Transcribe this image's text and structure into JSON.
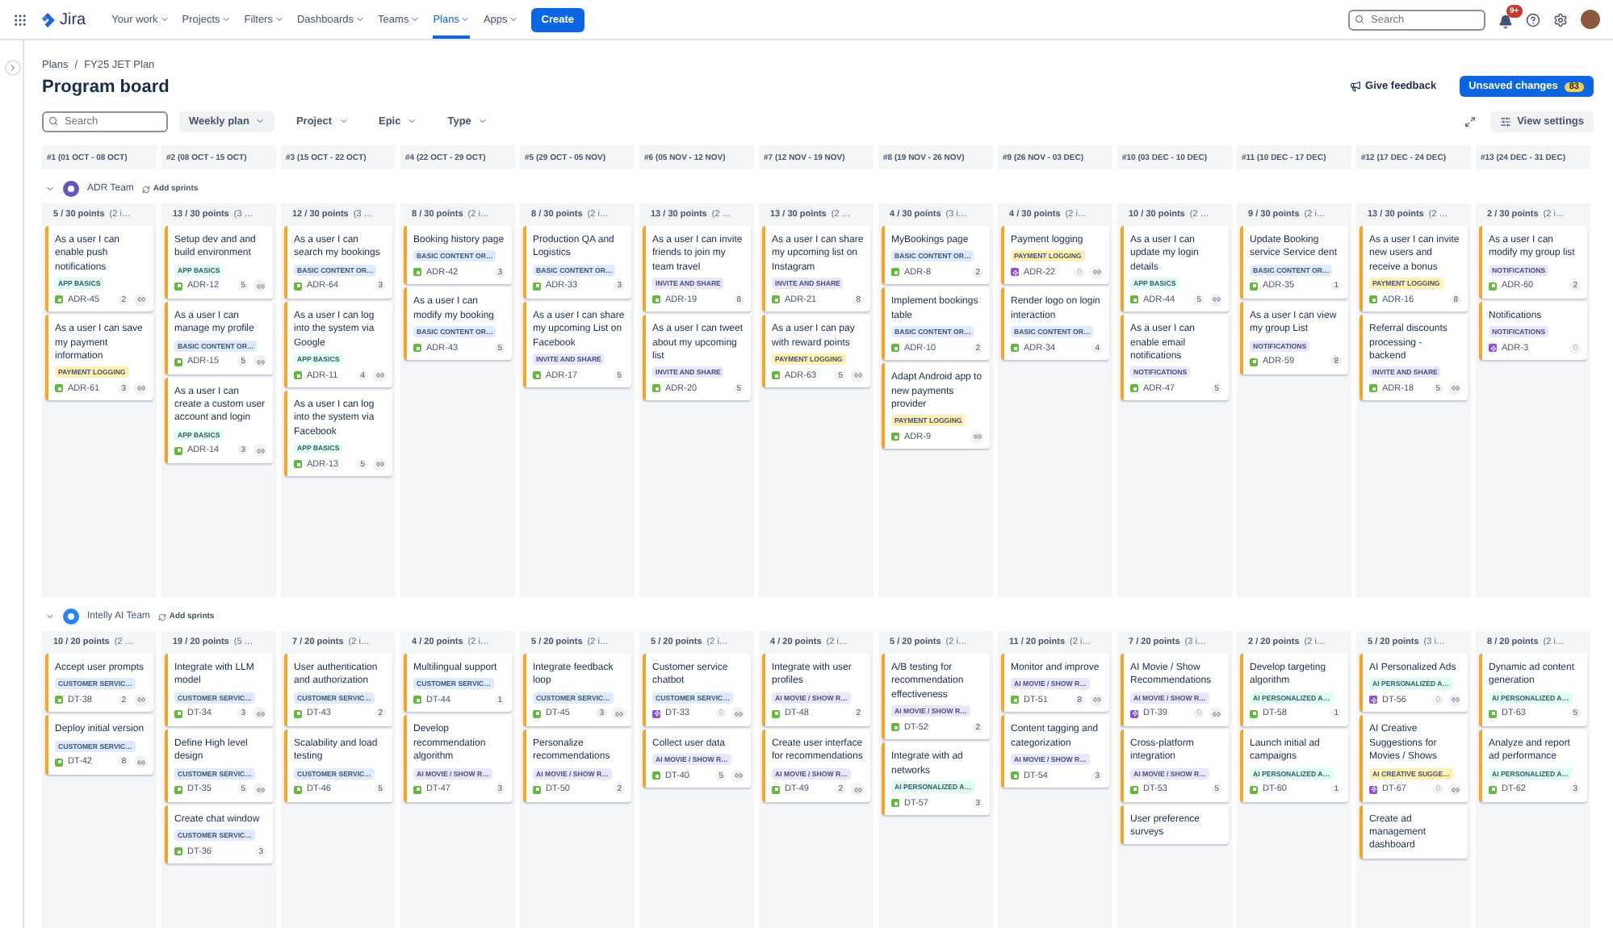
{
  "nav": {
    "product": "Jira",
    "items": [
      {
        "label": "Your work",
        "selected": false
      },
      {
        "label": "Projects",
        "selected": false
      },
      {
        "label": "Filters",
        "selected": false
      },
      {
        "label": "Dashboards",
        "selected": false
      },
      {
        "label": "Teams",
        "selected": false
      },
      {
        "label": "Plans",
        "selected": true
      },
      {
        "label": "Apps",
        "selected": false
      }
    ],
    "create": "Create",
    "search": {
      "placeholder": "Search"
    },
    "notifications": "9+"
  },
  "breadcrumbs": {
    "items": [
      "Plans",
      "FY25 JET Plan"
    ],
    "separator": "/"
  },
  "title": "Program board",
  "feedback": "Give feedback",
  "unsaved": {
    "label": "Unsaved changes",
    "count": "83"
  },
  "filters": {
    "search": {
      "placeholder": "Search"
    },
    "dropdowns": [
      "Weekly plan",
      "Project",
      "Epic",
      "Type"
    ],
    "view_settings": "View settings"
  },
  "sprints": [
    "#1 (01 OCT - 08 OCT)",
    "#2 (08 OCT - 15 OCT)",
    "#3 (15 OCT - 22 OCT)",
    "#4 (22 OCT - 29 OCT)",
    "#5 (29 OCT - 05 NOV)",
    "#6 (05 NOV - 12 NOV)",
    "#7 (12 NOV - 19 NOV)",
    "#8 (19 NOV - 26 NOV)",
    "#9 (26 NOV - 03 DEC)",
    "#10 (03 DEC - 10 DEC)",
    "#11 (10 DEC - 17 DEC)",
    "#12 (17 DEC - 24 DEC)",
    "#13 (24 DEC - 31 DEC)"
  ],
  "teams": [
    {
      "name": "ADR Team",
      "add": "Add sprints",
      "expanded": true,
      "color": "#6554c0",
      "columns": [
        {
          "points": "5 / 30 points",
          "summary": "(2 i…",
          "cards": [
            {
              "title": "As a user I can enable push notifications",
              "tag": {
                "label": "APP BASICS",
                "color": "#dcfff1"
              },
              "key": "ADR-45",
              "kind": "story",
              "points": "2",
              "linked": true
            },
            {
              "title": "As a user I can save my payment information",
              "tag": {
                "label": "PAYMENT LOGGING",
                "color": "#fff0b3"
              },
              "key": "ADR-61",
              "kind": "story",
              "points": "3",
              "linked": true
            }
          ]
        },
        {
          "points": "13 / 30 points",
          "summary": "(3 …",
          "cards": [
            {
              "title": "Setup dev and and build environment",
              "tag": {
                "label": "APP BASICS",
                "color": "#dcfff1"
              },
              "key": "ADR-12",
              "kind": "story",
              "points": "5",
              "linked": true
            },
            {
              "title": "As a user I can manage my profile",
              "tag": {
                "label": "BASIC CONTENT OR…",
                "color": "#deebff"
              },
              "key": "ADR-15",
              "kind": "story",
              "points": "5",
              "linked": true
            },
            {
              "title": "As a user I can create a custom user account and login",
              "tag": {
                "label": "APP BASICS",
                "color": "#dcfff1"
              },
              "key": "ADR-14",
              "kind": "story",
              "points": "3",
              "linked": true
            }
          ]
        },
        {
          "points": "12 / 30 points",
          "summary": "(3 …",
          "cards": [
            {
              "title": "As a user I can search my bookings",
              "tag": {
                "label": "BASIC CONTENT OR…",
                "color": "#deebff"
              },
              "key": "ADR-64",
              "kind": "story",
              "points": "3",
              "linked": false
            },
            {
              "title": "As a user I can log into the system via Google",
              "tag": {
                "label": "APP BASICS",
                "color": "#dcfff1"
              },
              "key": "ADR-11",
              "kind": "story",
              "points": "4",
              "linked": true
            },
            {
              "title": "As a user I can log into the system via Facebook",
              "tag": {
                "label": "APP BASICS",
                "color": "#dcfff1"
              },
              "key": "ADR-13",
              "kind": "story",
              "points": "5",
              "linked": true
            }
          ]
        },
        {
          "points": "8 / 30 points",
          "summary": "(2 i…",
          "cards": [
            {
              "title": "Booking history page",
              "tag": {
                "label": "BASIC CONTENT OR…",
                "color": "#deebff"
              },
              "key": "ADR-42",
              "kind": "story",
              "points": "3",
              "linked": false
            },
            {
              "title": "As a user I can modify my booking",
              "tag": {
                "label": "BASIC CONTENT OR…",
                "color": "#deebff"
              },
              "key": "ADR-43",
              "kind": "story",
              "points": "5",
              "linked": false
            }
          ]
        },
        {
          "points": "8 / 30 points",
          "summary": "(2 i…",
          "cards": [
            {
              "title": "Production QA and Logistics",
              "tag": {
                "label": "BASIC CONTENT OR…",
                "color": "#deebff"
              },
              "key": "ADR-33",
              "kind": "story",
              "points": "3",
              "linked": false
            },
            {
              "title": "As a user I can share my upcoming List on Facebook",
              "tag": {
                "label": "INVITE AND SHARE",
                "color": "#eae6ff"
              },
              "key": "ADR-17",
              "kind": "story",
              "points": "5",
              "linked": false
            }
          ]
        },
        {
          "points": "13 / 30 points",
          "summary": "(2 …",
          "cards": [
            {
              "title": "As a user I can invite friends to join my team travel",
              "tag": {
                "label": "INVITE AND SHARE",
                "color": "#eae6ff"
              },
              "key": "ADR-19",
              "kind": "story",
              "points": "8",
              "linked": false
            },
            {
              "title": "As a user I can tweet about my upcoming list",
              "tag": {
                "label": "INVITE AND SHARE",
                "color": "#eae6ff"
              },
              "key": "ADR-20",
              "kind": "story",
              "points": "5",
              "linked": false
            }
          ]
        },
        {
          "points": "13 / 30 points",
          "summary": "(2 …",
          "cards": [
            {
              "title": "As a user I can share my upcoming list on Instagram",
              "tag": {
                "label": "INVITE AND SHARE",
                "color": "#eae6ff"
              },
              "key": "ADR-21",
              "kind": "story",
              "points": "8",
              "linked": false
            },
            {
              "title": "As a user I can pay with reward points",
              "tag": {
                "label": "PAYMENT LOGGING",
                "color": "#fff0b3"
              },
              "key": "ADR-63",
              "kind": "story",
              "points": "5",
              "linked": true
            }
          ]
        },
        {
          "points": "4 / 30 points",
          "summary": "(3 i…",
          "cards": [
            {
              "title": "MyBookings page",
              "tag": {
                "label": "BASIC CONTENT OR…",
                "color": "#deebff"
              },
              "key": "ADR-8",
              "kind": "story",
              "points": "2",
              "linked": false
            },
            {
              "title": "Implement bookings table",
              "tag": {
                "label": "BASIC CONTENT OR…",
                "color": "#deebff"
              },
              "key": "ADR-10",
              "kind": "story",
              "points": "2",
              "linked": false
            },
            {
              "title": "Adapt Android app to new payments provider",
              "tag": {
                "label": "PAYMENT LOGGING",
                "color": "#fff0b3"
              },
              "key": "ADR-9",
              "kind": "story",
              "linked": true
            }
          ]
        },
        {
          "points": "4 / 30 points",
          "summary": "(2 i…",
          "cards": [
            {
              "title": "Payment logging",
              "tag": {
                "label": "PAYMENT LOGGING",
                "color": "#fff0b3"
              },
              "key": "ADR-22",
              "kind": "epic",
              "points": "0",
              "linked": true
            },
            {
              "title": "Render logo on login interaction",
              "tag": {
                "label": "BASIC CONTENT OR…",
                "color": "#deebff"
              },
              "key": "ADR-34",
              "kind": "story",
              "points": "4",
              "linked": false
            }
          ]
        },
        {
          "points": "10 / 30 points",
          "summary": "(2 …",
          "cards": [
            {
              "title": "As a user I can update my login details",
              "tag": {
                "label": "APP BASICS",
                "color": "#dcfff1"
              },
              "key": "ADR-44",
              "kind": "story",
              "points": "5",
              "linked": true
            },
            {
              "title": "As a user I can enable email notifications",
              "tag": {
                "label": "NOTIFICATIONS",
                "color": "#eae6ff"
              },
              "key": "ADR-47",
              "kind": "story",
              "points": "5",
              "linked": false
            }
          ]
        },
        {
          "points": "9 / 30 points",
          "summary": "(2 i…",
          "cards": [
            {
              "title": "Update Booking service Service dent",
              "tag": {
                "label": "BASIC CONTENT OR…",
                "color": "#deebff"
              },
              "key": "ADR-35",
              "kind": "story",
              "points": "1",
              "linked": false
            },
            {
              "title": "As a user I can view my group List",
              "tag": {
                "label": "NOTIFICATIONS",
                "color": "#eae6ff"
              },
              "key": "ADR-59",
              "kind": "story",
              "points": "8",
              "linked": false
            }
          ]
        },
        {
          "points": "13 / 30 points",
          "summary": "(2 …",
          "cards": [
            {
              "title": "As a user I can invite new users and receive a bonus",
              "tag": {
                "label": "PAYMENT LOGGING",
                "color": "#fff0b3"
              },
              "key": "ADR-16",
              "kind": "story",
              "points": "8",
              "linked": false
            },
            {
              "title": "Referral discounts processing - backend",
              "tag": {
                "label": "INVITE AND SHARE",
                "color": "#eae6ff"
              },
              "key": "ADR-18",
              "kind": "story",
              "points": "5",
              "linked": true
            }
          ]
        },
        {
          "points": "2 / 30 points",
          "summary": "(2 i…",
          "cards": [
            {
              "title": "As a user I can modify my group list",
              "tag": {
                "label": "NOTIFICATIONS",
                "color": "#eae6ff"
              },
              "key": "ADR-60",
              "kind": "story",
              "points": "2",
              "linked": false
            },
            {
              "title": "Notifications",
              "tag": {
                "label": "NOTIFICATIONS",
                "color": "#eae6ff"
              },
              "key": "ADR-3",
              "kind": "epic",
              "points": "0",
              "linked": false
            }
          ]
        }
      ]
    },
    {
      "name": "Intelly AI Team",
      "add": "Add sprints",
      "expanded": true,
      "color": "#2684ff",
      "columns": [
        {
          "points": "10 / 20 points",
          "summary": "(2 …",
          "cards": [
            {
              "title": "Accept user prompts",
              "tag": {
                "label": "CUSTOMER SERVIC…",
                "color": "#deebff"
              },
              "key": "DT-38",
              "kind": "story",
              "points": "2",
              "linked": true
            },
            {
              "title": "Deploy initial version",
              "tag": {
                "label": "CUSTOMER SERVIC…",
                "color": "#deebff"
              },
              "key": "DT-42",
              "kind": "story",
              "points": "8",
              "linked": true
            }
          ]
        },
        {
          "points": "19 / 20 points",
          "summary": "(5 …",
          "cards": [
            {
              "title": "Integrate with LLM model",
              "tag": {
                "label": "CUSTOMER SERVIC…",
                "color": "#deebff"
              },
              "key": "DT-34",
              "kind": "story",
              "points": "3",
              "linked": true
            },
            {
              "title": "Define High level design",
              "tag": {
                "label": "CUSTOMER SERVIC…",
                "color": "#deebff"
              },
              "key": "DT-35",
              "kind": "story",
              "points": "5",
              "linked": true
            },
            {
              "title": "Create chat window",
              "tag": {
                "label": "CUSTOMER SERVIC…",
                "color": "#deebff"
              },
              "key": "DT-36",
              "kind": "story",
              "points": "3",
              "linked": false
            }
          ]
        },
        {
          "points": "7 / 20 points",
          "summary": "(2 i…",
          "cards": [
            {
              "title": "User authentication and authorization",
              "tag": {
                "label": "CUSTOMER SERVIC…",
                "color": "#deebff"
              },
              "key": "DT-43",
              "kind": "story",
              "points": "2",
              "linked": false
            },
            {
              "title": "Scalability and load testing",
              "tag": {
                "label": "CUSTOMER SERVIC…",
                "color": "#deebff"
              },
              "key": "DT-46",
              "kind": "story",
              "points": "5",
              "linked": false
            }
          ]
        },
        {
          "points": "4 / 20 points",
          "summary": "(2 i…",
          "cards": [
            {
              "title": "Multilingual support",
              "tag": {
                "label": "CUSTOMER SERVIC…",
                "color": "#deebff"
              },
              "key": "DT-44",
              "kind": "story",
              "points": "1",
              "linked": false
            },
            {
              "title": "Develop recommendation algorithm",
              "tag": {
                "label": "AI MOVIE / SHOW R…",
                "color": "#eae6ff"
              },
              "key": "DT-47",
              "kind": "story",
              "points": "3",
              "linked": false
            }
          ]
        },
        {
          "points": "5 / 20 points",
          "summary": "(2 i…",
          "cards": [
            {
              "title": "Integrate feedback loop",
              "tag": {
                "label": "CUSTOMER SERVIC…",
                "color": "#deebff"
              },
              "key": "DT-45",
              "kind": "story",
              "points": "3",
              "linked": true
            },
            {
              "title": "Personalize recommendations",
              "tag": {
                "label": "AI MOVIE / SHOW R…",
                "color": "#eae6ff"
              },
              "key": "DT-50",
              "kind": "story",
              "points": "2",
              "linked": false
            }
          ]
        },
        {
          "points": "5 / 20 points",
          "summary": "(2 i…",
          "cards": [
            {
              "title": "Customer service chatbot",
              "tag": {
                "label": "CUSTOMER SERVIC…",
                "color": "#deebff"
              },
              "key": "DT-33",
              "kind": "epic",
              "points": "0",
              "linked": true
            },
            {
              "title": "Collect user data",
              "tag": {
                "label": "AI MOVIE / SHOW R…",
                "color": "#eae6ff"
              },
              "key": "DT-40",
              "kind": "story",
              "points": "5",
              "linked": true
            }
          ]
        },
        {
          "points": "4 / 20 points",
          "summary": "(2 i…",
          "cards": [
            {
              "title": "Integrate with user profiles",
              "tag": {
                "label": "AI MOVIE / SHOW R…",
                "color": "#eae6ff"
              },
              "key": "DT-48",
              "kind": "story",
              "points": "2",
              "linked": false
            },
            {
              "title": "Create user interface for recommendations",
              "tag": {
                "label": "AI MOVIE / SHOW R…",
                "color": "#eae6ff"
              },
              "key": "DT-49",
              "kind": "story",
              "points": "2",
              "linked": true
            }
          ]
        },
        {
          "points": "5 / 20 points",
          "summary": "(2 i…",
          "cards": [
            {
              "title": "A/B testing for recommendation effectiveness",
              "tag": {
                "label": "AI MOVIE / SHOW R…",
                "color": "#eae6ff"
              },
              "key": "DT-52",
              "kind": "story",
              "points": "2",
              "linked": false
            },
            {
              "title": "Integrate with ad networks",
              "tag": {
                "label": "AI PERSONALIZED A…",
                "color": "#dcfff1"
              },
              "key": "DT-57",
              "kind": "story",
              "points": "3",
              "linked": false
            }
          ]
        },
        {
          "points": "11 / 20 points",
          "summary": "(2 i…",
          "cards": [
            {
              "title": "Monitor and improve",
              "tag": {
                "label": "AI MOVIE / SHOW R…",
                "color": "#eae6ff"
              },
              "key": "DT-51",
              "kind": "story",
              "points": "8",
              "linked": true
            },
            {
              "title": "Content tagging and categorization",
              "tag": {
                "label": "AI MOVIE / SHOW R…",
                "color": "#eae6ff"
              },
              "key": "DT-54",
              "kind": "story",
              "points": "3",
              "linked": false
            }
          ]
        },
        {
          "points": "7 / 20 points",
          "summary": "(3 i…",
          "cards": [
            {
              "title": "AI Movie / Show Recommendations",
              "tag": {
                "label": "AI MOVIE / SHOW R…",
                "color": "#eae6ff"
              },
              "key": "DT-39",
              "kind": "epic",
              "points": "0",
              "linked": true
            },
            {
              "title": "Cross-platform integration",
              "tag": {
                "label": "AI MOVIE / SHOW R…",
                "color": "#eae6ff"
              },
              "key": "DT-53",
              "kind": "story",
              "points": "5",
              "linked": false
            },
            {
              "title": "User preference surveys"
            }
          ]
        },
        {
          "points": "2 / 20 points",
          "summary": "(2 i…",
          "cards": [
            {
              "title": "Develop targeting algorithm",
              "tag": {
                "label": "AI PERSONALIZED A…",
                "color": "#dcfff1"
              },
              "key": "DT-58",
              "kind": "story",
              "points": "1",
              "linked": false
            },
            {
              "title": "Launch initial ad campaigns",
              "tag": {
                "label": "AI PERSONALIZED A…",
                "color": "#dcfff1"
              },
              "key": "DT-60",
              "kind": "story",
              "points": "1",
              "linked": false
            }
          ]
        },
        {
          "points": "5 / 20 points",
          "summary": "(3 i…",
          "cards": [
            {
              "title": "AI Personalized Ads",
              "tag": {
                "label": "AI PERSONALIZED A…",
                "color": "#dcfff1"
              },
              "key": "DT-56",
              "kind": "epic",
              "points": "0",
              "linked": true
            },
            {
              "title": "AI Creative Suggestions for Movies / Shows",
              "tag": {
                "label": "AI CREATIVE SUGGE…",
                "color": "#fff0b3"
              },
              "key": "DT-67",
              "kind": "epic",
              "points": "0",
              "linked": true
            },
            {
              "title": "Create ad management dashboard"
            }
          ]
        },
        {
          "points": "8 / 20 points",
          "summary": "(2 i…",
          "cards": [
            {
              "title": "Dynamic ad content generation",
              "tag": {
                "label": "AI PERSONALIZED A…",
                "color": "#dcfff1"
              },
              "key": "DT-63",
              "kind": "story",
              "points": "5",
              "linked": false
            },
            {
              "title": "Analyze and report ad performance",
              "tag": {
                "label": "AI PERSONALIZED A…",
                "color": "#dcfff1"
              },
              "key": "DT-62",
              "kind": "story",
              "points": "3",
              "linked": false
            }
          ]
        }
      ]
    }
  ]
}
